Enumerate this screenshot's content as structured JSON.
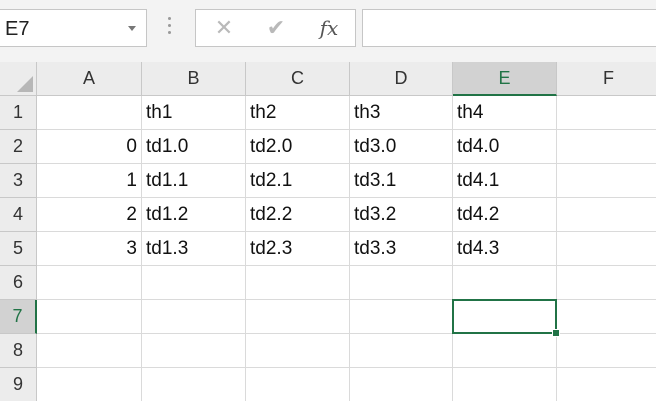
{
  "name_box": {
    "value": "E7",
    "dropdown_icon": "chevron-down-icon"
  },
  "formula_bar": {
    "cancel_icon": "✕",
    "enter_icon": "✔",
    "function_label": "fx",
    "value": ""
  },
  "columns": [
    "A",
    "B",
    "C",
    "D",
    "E",
    "F"
  ],
  "rows": [
    "1",
    "2",
    "3",
    "4",
    "5",
    "6",
    "7",
    "8",
    "9"
  ],
  "active_cell": {
    "column": "E",
    "row": "7"
  },
  "cells": {
    "B1": "th1",
    "C1": "th2",
    "D1": "th3",
    "E1": "th4",
    "A2": "0",
    "B2": "td1.0",
    "C2": "td2.0",
    "D2": "td3.0",
    "E2": "td4.0",
    "A3": "1",
    "B3": "td1.1",
    "C3": "td2.1",
    "D3": "td3.1",
    "E3": "td4.1",
    "A4": "2",
    "B4": "td1.2",
    "C4": "td2.2",
    "D4": "td3.2",
    "E4": "td4.2",
    "A5": "3",
    "B5": "td1.3",
    "C5": "td2.3",
    "D5": "td3.3",
    "E5": "td4.3"
  },
  "colors": {
    "accent": "#217346",
    "header_bg": "#ececec",
    "header_active_bg": "#d2d2d2",
    "gridline": "#dadada"
  }
}
